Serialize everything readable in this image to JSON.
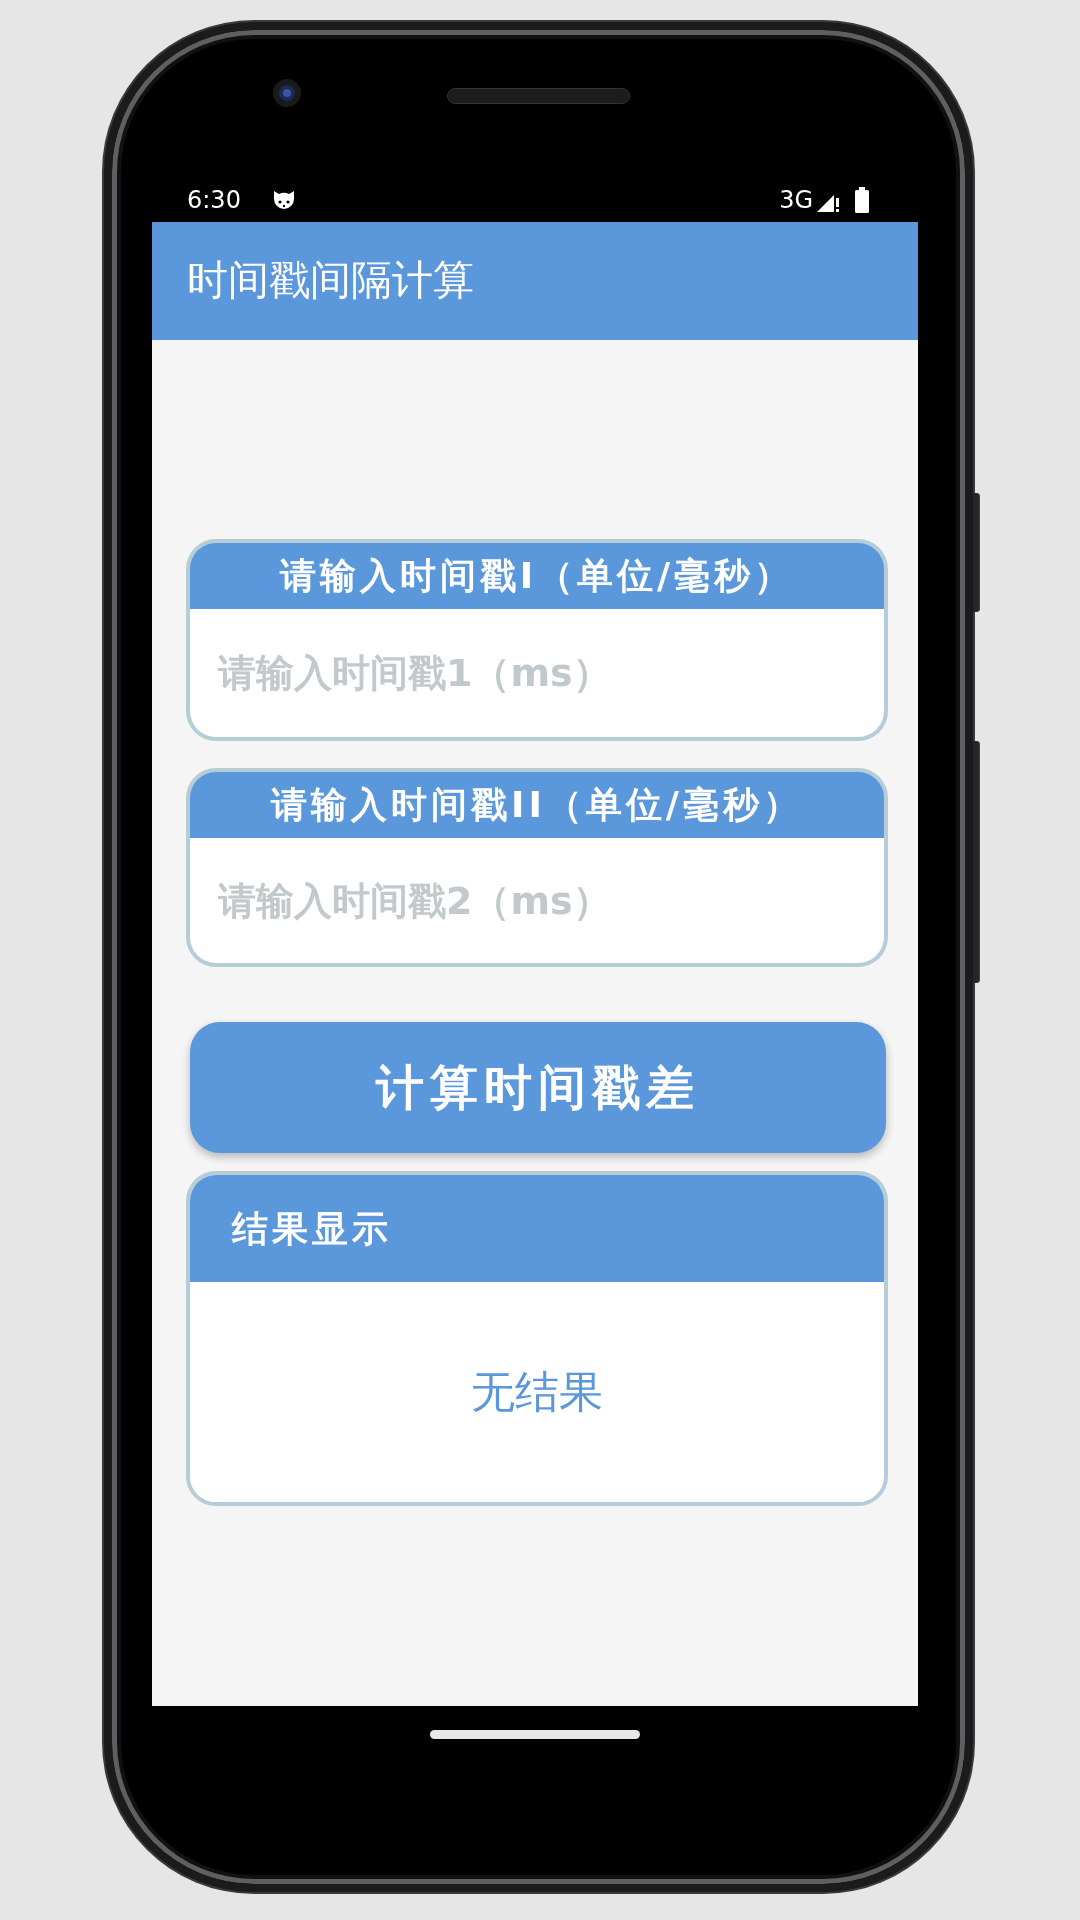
{
  "status_bar": {
    "time": "6:30",
    "network": "3G"
  },
  "app_bar": {
    "title": "时间戳间隔计算"
  },
  "inputs": [
    {
      "label": "请输入时间戳I（单位/毫秒）",
      "placeholder": "请输入时间戳1（ms）"
    },
    {
      "label": "请输入时间戳II（单位/毫秒）",
      "placeholder": "请输入时间戳2（ms）"
    }
  ],
  "button": {
    "label": "计算时间戳差"
  },
  "result": {
    "title": "结果显示",
    "value": "无结果"
  }
}
